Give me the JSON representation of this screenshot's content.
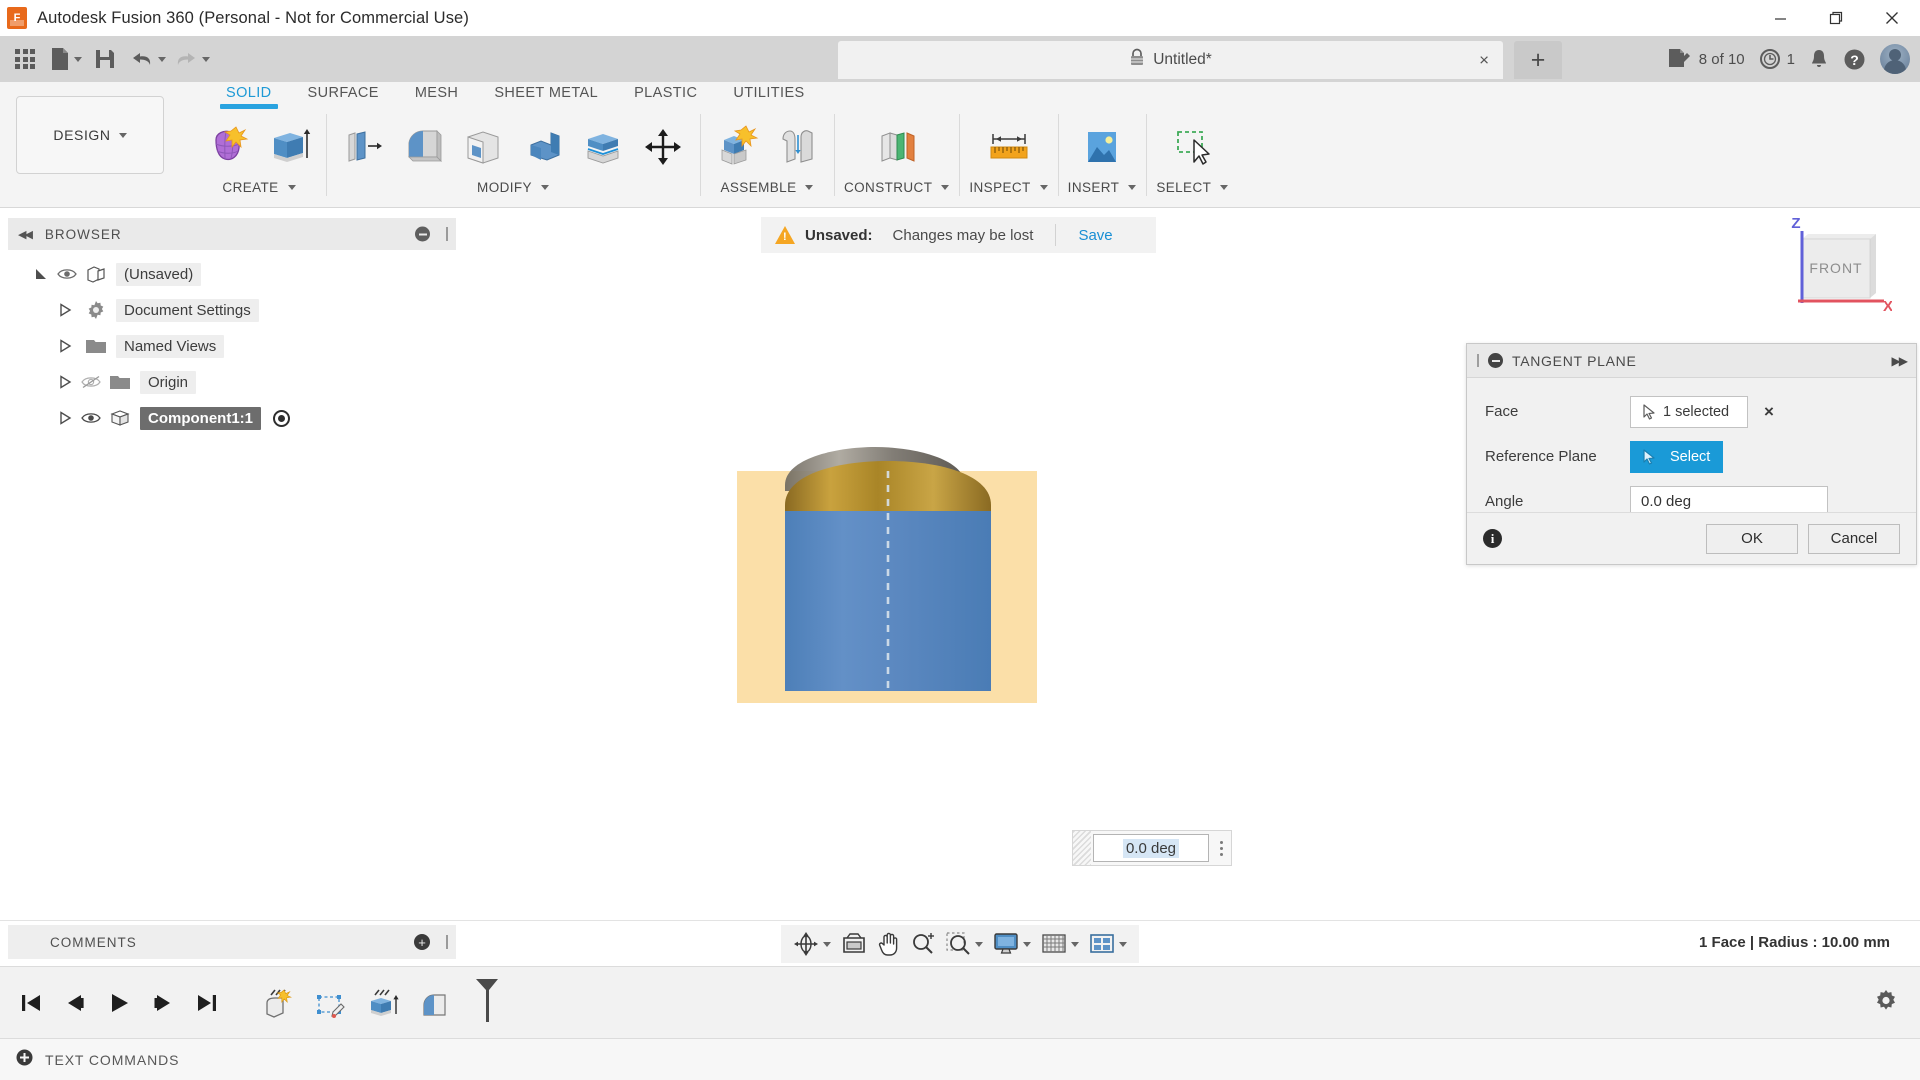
{
  "window": {
    "app_title": "Autodesk Fusion 360 (Personal - Not for Commercial Use)",
    "logo_letter": "F",
    "minimize": "minimize-icon",
    "maximize": "restore-icon",
    "close": "close-icon"
  },
  "quick_access": {
    "app_grid": "grid-icon",
    "new": "new-file-icon",
    "save": "save-icon",
    "undo": "undo-icon",
    "redo": "redo-icon",
    "doc_tab_title": "Untitled*",
    "doc_tab_lock": "lock-icon",
    "doc_tab_close": "×",
    "new_tab": "+",
    "jobs_label": "8 of 10",
    "history_label": "1",
    "notifications": "bell-icon",
    "help": "help-icon",
    "account": "avatar"
  },
  "ribbon": {
    "design_label": "DESIGN",
    "workspace_tabs": [
      {
        "label": "SOLID",
        "active": true
      },
      {
        "label": "SURFACE",
        "active": false
      },
      {
        "label": "MESH",
        "active": false
      },
      {
        "label": "SHEET METAL",
        "active": false
      },
      {
        "label": "PLASTIC",
        "active": false
      },
      {
        "label": "UTILITIES",
        "active": false
      }
    ],
    "groups": [
      {
        "label": "CREATE",
        "has_caret": true,
        "icons": [
          "create-form-icon",
          "extrude-icon"
        ]
      },
      {
        "label": "MODIFY",
        "has_caret": true,
        "icons": [
          "press-pull-icon",
          "fillet-icon",
          "shell-icon",
          "combine-icon",
          "split-face-icon",
          "move-copy-icon"
        ]
      },
      {
        "label": "ASSEMBLE",
        "has_caret": true,
        "icons": [
          "new-component-icon",
          "joint-icon"
        ]
      },
      {
        "label": "CONSTRUCT",
        "has_caret": true,
        "icons": [
          "offset-plane-icon"
        ]
      },
      {
        "label": "INSPECT",
        "has_caret": true,
        "icons": [
          "measure-icon"
        ]
      },
      {
        "label": "INSERT",
        "has_caret": true,
        "icons": [
          "insert-image-icon"
        ]
      },
      {
        "label": "SELECT",
        "has_caret": true,
        "icons": [
          "window-selection-icon"
        ]
      }
    ]
  },
  "browser": {
    "title": "BROWSER",
    "collapse": "collapse-left-icon",
    "minimize": "minimize-panel-icon",
    "nodes": [
      {
        "label": "(Unsaved)",
        "indent": 0,
        "disclosure": "expanded",
        "eye": "visible",
        "icon": "document-icon",
        "selected": false,
        "radio": false
      },
      {
        "label": "Document Settings",
        "indent": 1,
        "disclosure": "collapsed",
        "eye": "none",
        "icon": "gear-icon",
        "selected": false,
        "radio": false
      },
      {
        "label": "Named Views",
        "indent": 1,
        "disclosure": "collapsed",
        "eye": "none",
        "icon": "folder-icon",
        "selected": false,
        "radio": false
      },
      {
        "label": "Origin",
        "indent": 1,
        "disclosure": "collapsed",
        "eye": "hidden",
        "icon": "folder-icon",
        "selected": false,
        "radio": false
      },
      {
        "label": "Component1:1",
        "indent": 1,
        "disclosure": "collapsed",
        "eye": "visible",
        "icon": "component-icon",
        "selected": true,
        "radio": true
      }
    ]
  },
  "canvas": {
    "unsaved": {
      "warning_icon": "warning-icon",
      "label": "Unsaved:",
      "message": "Changes may be lost",
      "save_link": "Save"
    },
    "viewcube": {
      "face": "FRONT",
      "axis_z": "Z",
      "axis_x": "X",
      "z_color": "#5b5bd6",
      "x_color": "#e8606b"
    },
    "angle_manipulator": {
      "value": "0.0 deg",
      "grip": "drag-grip",
      "menu": "more-options-icon"
    },
    "model": {
      "body_color": "#5585c0",
      "cap_color": "#b08c34",
      "plane_color": "#fbdfa8"
    }
  },
  "dialog": {
    "title": "TANGENT PLANE",
    "collapse_icon": "collapse-icon",
    "expand_icon": "expand-right-icon",
    "rows": [
      {
        "label": "Face",
        "control": "selection",
        "value": "1 selected",
        "cursor_icon": "pointer-icon",
        "clear": "×"
      },
      {
        "label": "Reference Plane",
        "control": "select-button",
        "value": "Select",
        "cursor_icon": "pointer-icon"
      },
      {
        "label": "Angle",
        "control": "input",
        "value": "0.0 deg"
      }
    ],
    "info_icon": "info-icon",
    "ok_label": "OK",
    "cancel_label": "Cancel"
  },
  "comments": {
    "title": "COMMENTS",
    "add": "add-comment-icon"
  },
  "navbar": {
    "items": [
      {
        "name": "orbit-icon",
        "caret": true
      },
      {
        "name": "look-at-icon",
        "caret": false
      },
      {
        "name": "pan-icon",
        "caret": false
      },
      {
        "name": "zoom-icon",
        "caret": false
      },
      {
        "name": "zoom-window-icon",
        "caret": true
      },
      {
        "name": "display-settings-icon",
        "caret": true
      },
      {
        "name": "grid-snaps-icon",
        "caret": true
      },
      {
        "name": "viewports-icon",
        "caret": true
      }
    ]
  },
  "status": {
    "selection_info": "1 Face | Radius : 10.00 mm"
  },
  "timeline": {
    "playback": [
      {
        "name": "go-to-beginning-icon"
      },
      {
        "name": "step-back-icon"
      },
      {
        "name": "play-icon"
      },
      {
        "name": "step-forward-icon"
      },
      {
        "name": "go-to-end-icon"
      }
    ],
    "features": [
      {
        "name": "create-form-feature-icon"
      },
      {
        "name": "sketch-feature-icon"
      },
      {
        "name": "extrude-feature-icon"
      },
      {
        "name": "fillet-feature-icon"
      }
    ],
    "marker": "timeline-marker",
    "settings": "gear-icon"
  },
  "text_commands": {
    "expand": "expand-icon",
    "label": "TEXT COMMANDS"
  }
}
